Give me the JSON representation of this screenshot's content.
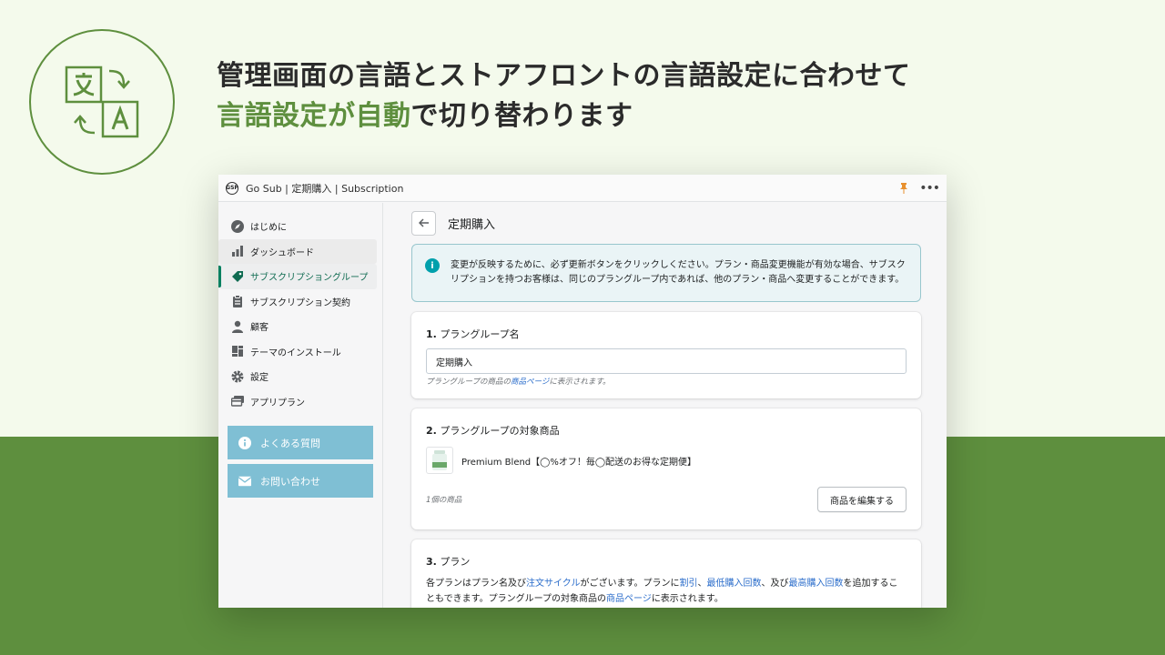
{
  "headline": {
    "line1": "管理画面の言語とストアフロントの言語設定に合わせて",
    "line2_accent": "言語設定が自動",
    "line2_rest": "で切り替わります"
  },
  "window": {
    "title": "Go Sub | 定期購入 | Subscription",
    "logo_text": "GSP"
  },
  "sidebar": {
    "items": [
      {
        "label": "はじめに",
        "icon": "compass-icon"
      },
      {
        "label": "ダッシュボード",
        "icon": "bar-chart-icon"
      },
      {
        "label": "サブスクリプショングループ",
        "icon": "tag-icon"
      },
      {
        "label": "サブスクリプション契約",
        "icon": "clipboard-icon"
      },
      {
        "label": "顧客",
        "icon": "person-icon"
      },
      {
        "label": "テーマのインストール",
        "icon": "layout-icon"
      },
      {
        "label": "設定",
        "icon": "gear-icon"
      },
      {
        "label": "アプリプラン",
        "icon": "card-icon"
      }
    ],
    "faq_label": "よくある質問",
    "contact_label": "お問い合わせ"
  },
  "main": {
    "title": "定期購入",
    "banner": "変更が反映するために、必ず更新ボタンをクリックしください。プラン・商品変更機能が有効な場合、サブスクリプションを持つお客様は、同じのプラングループ内であれば、他のプラン・商品へ変更することができます。",
    "section1": {
      "num": "1.",
      "title": "プラングループ名",
      "input_value": "定期購入",
      "help_pre": "プラングループの商品の",
      "help_link": "商品ページ",
      "help_post": "に表示されます。"
    },
    "section2": {
      "num": "2.",
      "title": "プラングループの対象商品",
      "product_name": "Premium Blend【◯%オフ！毎◯配送のお得な定期便】",
      "count": "1個の商品",
      "edit_button": "商品を編集する"
    },
    "section3": {
      "num": "3.",
      "title": "プラン",
      "d1": "各プランはプラン名及び",
      "l1": "注文サイクル",
      "d2": "がございます。プランに",
      "l2": "割引",
      "d3": "、",
      "l3": "最低購入回数",
      "d4": "、及び",
      "l4": "最高購入回数",
      "d5": "を追加することもできます。プラングループの対象商品の",
      "l5": "商品ページ",
      "d6": "に表示されます。"
    }
  },
  "colors": {
    "brand_green": "#5e8f3e",
    "background": "#f4faec",
    "sidebar_button": "#7fbfd4",
    "info_banner": "#eaf4f6",
    "link": "#2c6ecb"
  }
}
